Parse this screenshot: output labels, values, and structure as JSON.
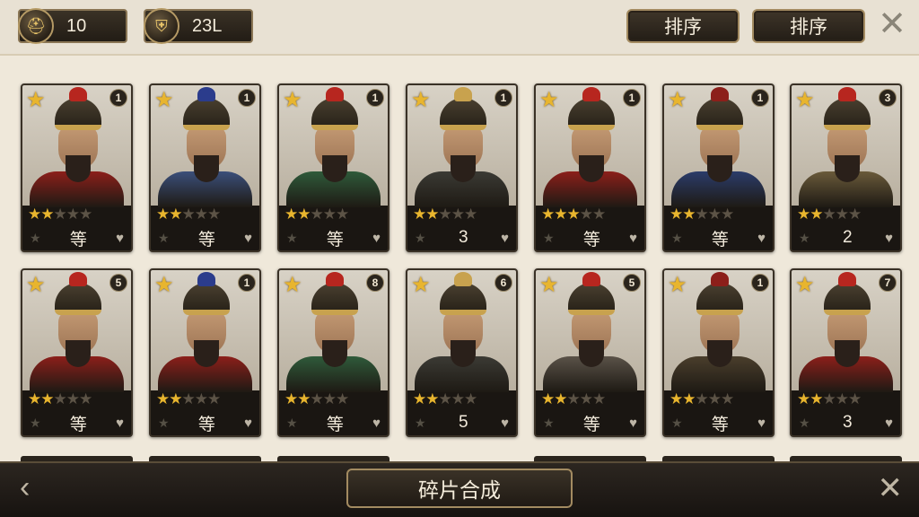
{
  "topbar": {
    "resource1": {
      "icon": "helmet-coin-icon",
      "value": "10"
    },
    "resource2": {
      "icon": "armor-coin-icon",
      "value": "23L"
    },
    "sort_label_1": "排序",
    "sort_label_2": "排序",
    "close_glyph": "✕"
  },
  "cards": [
    {
      "level": "1",
      "stars": 2,
      "label": "等",
      "plume": "#b7261f",
      "armor": "#8c1f1a"
    },
    {
      "level": "1",
      "stars": 2,
      "label": "等",
      "plume": "#2b3c8c",
      "armor": "#3b4f7a"
    },
    {
      "level": "1",
      "stars": 2,
      "label": "等",
      "plume": "#b7261f",
      "armor": "#2f5a3a"
    },
    {
      "level": "1",
      "stars": 2,
      "label": "3",
      "plume": "#c8a24e",
      "armor": "#3b3a34"
    },
    {
      "level": "1",
      "stars": 3,
      "label": "等",
      "plume": "#b7261f",
      "armor": "#8c1f1a"
    },
    {
      "level": "1",
      "stars": 2,
      "label": "等",
      "plume": "#8c1f1a",
      "armor": "#2b3c6a"
    },
    {
      "level": "3",
      "stars": 2,
      "label": "2",
      "plume": "#b7261f",
      "armor": "#6a5a3a"
    },
    {
      "level": "5",
      "stars": 2,
      "label": "等",
      "plume": "#b7261f",
      "armor": "#8c1f1a"
    },
    {
      "level": "1",
      "stars": 2,
      "label": "等",
      "plume": "#2b3c8c",
      "armor": "#8c1f1a"
    },
    {
      "level": "8",
      "stars": 2,
      "label": "等",
      "plume": "#b7261f",
      "armor": "#2f5a3a"
    },
    {
      "level": "6",
      "stars": 2,
      "label": "5",
      "plume": "#c8a24e",
      "armor": "#3b3a34"
    },
    {
      "level": "5",
      "stars": 2,
      "label": "等",
      "plume": "#b7261f",
      "armor": "#5a5248"
    },
    {
      "level": "1",
      "stars": 2,
      "label": "等",
      "plume": "#8c1f1a",
      "armor": "#4a3e2c"
    },
    {
      "level": "7",
      "stars": 2,
      "label": "3",
      "plume": "#b7261f",
      "armor": "#8c1f1a"
    }
  ],
  "bottombar": {
    "compose_label": "碎片合成",
    "prev_glyph": "‹",
    "close_glyph": "✕"
  }
}
